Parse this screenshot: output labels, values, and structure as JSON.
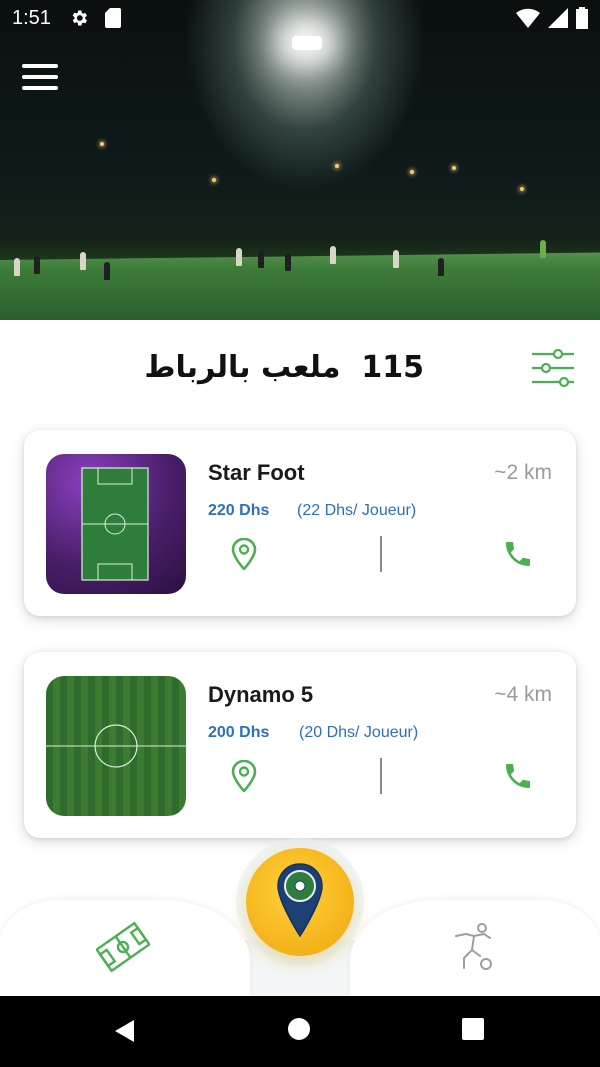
{
  "status_bar": {
    "time": "1:51",
    "icons_left": [
      "gear-icon",
      "sd-card-icon"
    ],
    "icons_right": [
      "wifi-icon",
      "signal-icon",
      "battery-icon"
    ]
  },
  "hero": {
    "image": "night-football-field-photo",
    "menu_icon": "hamburger-menu-icon"
  },
  "header": {
    "count": "115",
    "title_text": "ملعب بالرباط",
    "filter_icon": "sliders-filter-icon"
  },
  "fields": [
    {
      "name": "Star Foot",
      "distance": "~2 km",
      "price": "220 Dhs",
      "price_per_player": "(22 Dhs/ Joueur)",
      "thumbnail": "purple-lit-pitch-aerial",
      "location_icon": "map-pin-icon",
      "phone_icon": "phone-icon"
    },
    {
      "name": "Dynamo 5",
      "distance": "~4 km",
      "price": "200 Dhs",
      "price_per_player": "(20 Dhs/ Joueur)",
      "thumbnail": "green-grass-pitch-aerial",
      "location_icon": "map-pin-icon",
      "phone_icon": "phone-icon"
    }
  ],
  "bottom_nav": {
    "left_icon": "football-field-icon",
    "center_icon": "location-ball-icon",
    "right_icon": "player-kicking-icon"
  },
  "colors": {
    "accent_green": "#4caf50",
    "price_blue": "#2d6fbf",
    "fab_yellow": "#f4b21b"
  }
}
